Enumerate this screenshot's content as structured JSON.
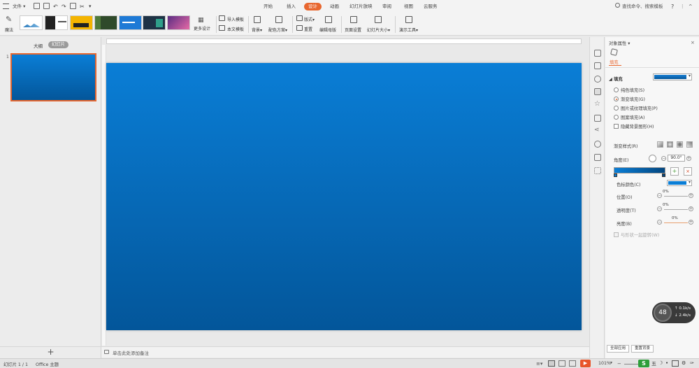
{
  "menubar": {
    "file_label": "文件",
    "tabs": [
      {
        "label": "开始",
        "active": false
      },
      {
        "label": "插入",
        "active": false
      },
      {
        "label": "设计",
        "active": true
      },
      {
        "label": "动画",
        "active": false
      },
      {
        "label": "幻灯片放映",
        "active": false
      },
      {
        "label": "审阅",
        "active": false
      },
      {
        "label": "视图",
        "active": false
      },
      {
        "label": "云服务",
        "active": false
      }
    ],
    "search_placeholder": "查找命令、搜索模板",
    "help": "?"
  },
  "ribbon": {
    "magic_label": "魔法",
    "more_design_label": "更多设计",
    "import_template_label": "导入模板",
    "text_template_label": "本文模板",
    "background_label": "背景",
    "color_scheme_label": "配色方案",
    "layout_label": "版式",
    "reset_label": "重置",
    "edit_master_label": "编辑母版",
    "page_setup_label": "页面设置",
    "slide_size_label": "幻灯片大小",
    "presentation_tools_label": "演示工具"
  },
  "leftpanel": {
    "tab_outline": "大纲",
    "tab_slides": "幻灯片",
    "slide_number": "1",
    "add_button": "+"
  },
  "notes": {
    "placeholder": "单击此处添加备注"
  },
  "props": {
    "title": "对象属性",
    "section_fill": "填充",
    "fill_header": "填充",
    "options": [
      {
        "label": "纯色填充(S)",
        "selected": false
      },
      {
        "label": "渐变填充(G)",
        "selected": true
      },
      {
        "label": "图片或纹理填充(P)",
        "selected": false
      },
      {
        "label": "图案填充(A)",
        "selected": false
      }
    ],
    "hide_bg_label": "隐藏背景图形(H)",
    "gradient_style_label": "渐变样式(R)",
    "angle_label": "角度(E)",
    "angle_value": "90.0°",
    "stop_color_label": "色标颜色(C)",
    "position_label": "位置(O)",
    "position_value": "0%",
    "transparency_label": "透明度(T)",
    "transparency_value": "0%",
    "brightness_label": "亮度(B)",
    "brightness_value": "0%",
    "rotate_with_shape_label": "与形状一起旋转(W)",
    "apply_all_label": "全部应用",
    "reset_bg_label": "重置背景"
  },
  "status": {
    "slide_info": "幻灯片 1 / 1",
    "theme": "Office 主题",
    "zoom": "101%",
    "badge_number": "48",
    "upload_speed": "0.1k/s",
    "download_speed": "2.4k/s"
  },
  "colors": {
    "accent": "#e8672f",
    "slide_top": "#0a7ed6",
    "slide_bottom": "#03569a",
    "fill_swatch": "#0a6cc4"
  }
}
